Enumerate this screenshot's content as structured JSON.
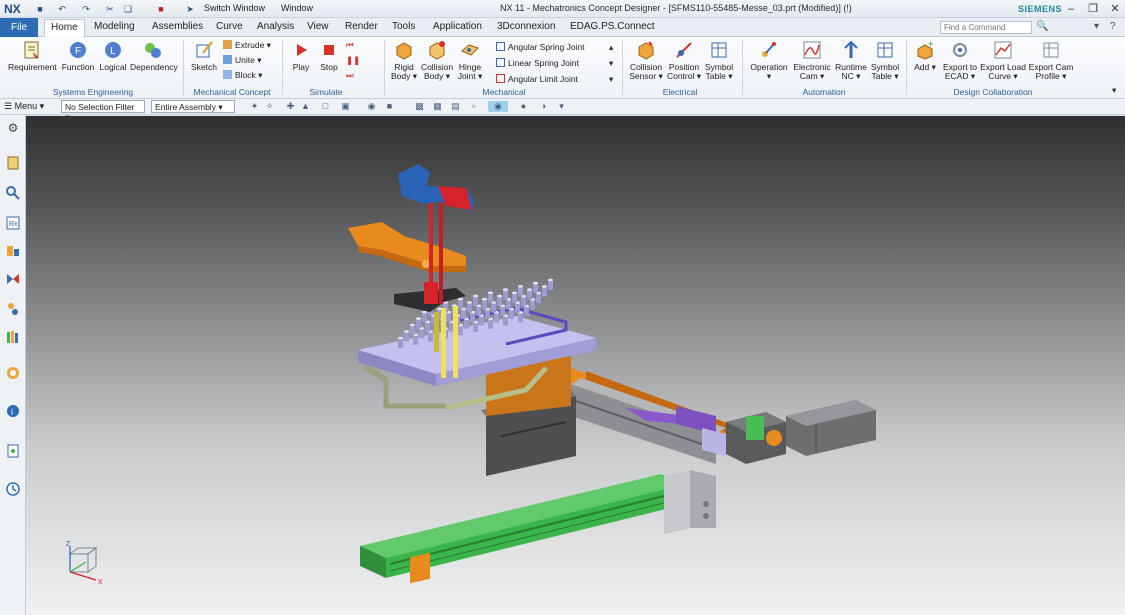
{
  "titlebar": {
    "logo": "NX",
    "switch_window": "Switch Window",
    "window_menu": "Window",
    "app_title": "NX 11 - Mechatronics Concept Designer - [SFMS110-55485-Messe_03.prt (Modified)]   (!)",
    "brand": "SIEMENS"
  },
  "tabs": {
    "file": "File",
    "home": "Home",
    "modeling": "Modeling",
    "assemblies": "Assemblies",
    "curve": "Curve",
    "analysis": "Analysis",
    "view": "View",
    "render": "Render",
    "tools": "Tools",
    "application": "Application",
    "3dconnexion": "3Dconnexion",
    "edag": "EDAG.PS.Connect",
    "find_command_placeholder": "Find a Command"
  },
  "ribbon": {
    "systems_engineering": {
      "label": "Systems Engineering",
      "requirement": "Requirement",
      "function": "Function",
      "logical": "Logical",
      "dependency": "Dependency"
    },
    "mechanical_concept": {
      "label": "Mechanical Concept",
      "sketch": "Sketch",
      "extrude": "Extrude",
      "unite": "Unite",
      "block": "Block"
    },
    "simulate": {
      "label": "Simulate",
      "play": "Play",
      "stop": "Stop"
    },
    "mechanical": {
      "label": "Mechanical",
      "rigid_body_1": "Rigid",
      "rigid_body_2": "Body",
      "collision_body_1": "Collision",
      "collision_body_2": "Body",
      "hinge_joint_1": "Hinge",
      "hinge_joint_2": "Joint",
      "angular_spring_joint": "Angular Spring Joint",
      "linear_spring_joint": "Linear Spring Joint",
      "angular_limit_joint": "Angular Limit Joint"
    },
    "electrical": {
      "label": "Electrical",
      "collision_sensor_1": "Collision",
      "collision_sensor_2": "Sensor",
      "position_control_1": "Position",
      "position_control_2": "Control",
      "symbol_table_1": "Symbol",
      "symbol_table_2": "Table"
    },
    "automation": {
      "label": "Automation",
      "operation": "Operation",
      "electronic_cam_1": "Electronic",
      "electronic_cam_2": "Cam",
      "runtime_nc_1": "Runtime",
      "runtime_nc_2": "NC",
      "symbol_table_1": "Symbol",
      "symbol_table_2": "Table"
    },
    "design_collaboration": {
      "label": "Design Collaboration",
      "add": "Add",
      "export_ecad_1": "Export to",
      "export_ecad_2": "ECAD",
      "export_load_curve_1": "Export Load",
      "export_load_curve_2": "Curve",
      "export_cam_profile_1": "Export Cam",
      "export_cam_profile_2": "Profile"
    }
  },
  "selection_bar": {
    "menu": "Menu",
    "filter": "No Selection Filter",
    "scope": "Entire Assembly"
  },
  "colors": {
    "file_tab": "#2e6db5",
    "ribbon_group_label": "#2f5f97",
    "model_orange": "#e98a1d",
    "model_green": "#39b54a",
    "model_lilac": "#b9b6e6",
    "model_red": "#d6222b",
    "model_blue": "#2a63b8"
  },
  "icons": [
    "search-icon",
    "save-icon",
    "undo-icon",
    "redo-icon",
    "play-icon",
    "stop-icon",
    "gear-icon",
    "orient-triad-icon"
  ]
}
